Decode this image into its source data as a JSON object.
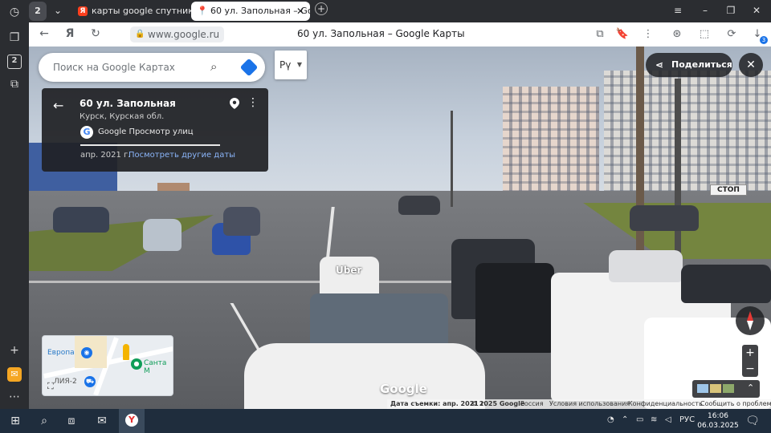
{
  "tabs": [
    {
      "label": "карты google спутник — ",
      "favicon": "Я",
      "favicon_color": "#fc3f1d"
    },
    {
      "label": "60 ул. Запольная – Goo",
      "favicon": "maps-pin",
      "favicon_color": "#ea4335"
    }
  ],
  "tab_counter": "2",
  "address_bar": {
    "domain": "www.google.ru",
    "page_title": "60 ул. Запольная – Google Карты"
  },
  "toolbar_badges": {
    "downloads": "3"
  },
  "search": {
    "placeholder": "Поиск на Google Картах"
  },
  "language_button": "Рү",
  "info_card": {
    "address": "60 ул. Запольная",
    "region": "Курск, Курская обл.",
    "source": "Google Просмотр улиц",
    "date": "апр. 2021 г.",
    "other_dates_link": "Посмотреть другие даты"
  },
  "share_label": "Поделиться",
  "minimap": {
    "label_europa": "Европа",
    "label_santa": "Санта М",
    "label_lia": "ЛИЯ-2"
  },
  "watermark": "Google",
  "footer": {
    "capture_date": "Дата съемки: апр. 2021 г.",
    "copyright": "© 2025 Google",
    "country": "Россия",
    "terms": "Условия использования",
    "privacy": "Конфиденциальность",
    "report": "Сообщить о проблеме"
  },
  "scene_signs": {
    "stop_sign": "СТОП",
    "taxi_sign": "Uber"
  },
  "taskbar": {
    "language": "РУС",
    "time": "16:06",
    "date": "06.03.2025"
  },
  "colors": {
    "accent": "#1a73e8",
    "taskbar": "#1f2d3d",
    "browser_chrome": "#2b2d31"
  }
}
